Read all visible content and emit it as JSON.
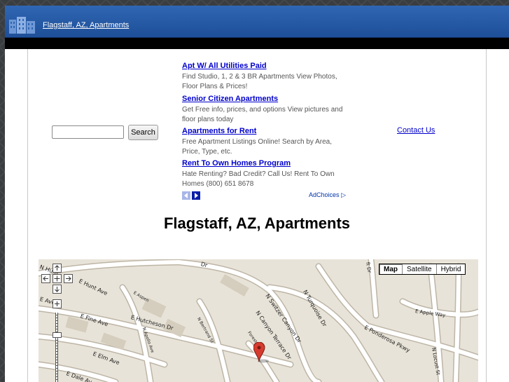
{
  "header": {
    "site_link": "Flagstaff, AZ, Apartments",
    "logo_icon": "apartment-building-icon"
  },
  "search": {
    "input_value": "",
    "button_label": "Search"
  },
  "ads": [
    {
      "title": "Apt W/ All Utilities Paid",
      "description": "Find Studio, 1, 2 & 3 BR Apartments View Photos, Floor Plans & Prices!"
    },
    {
      "title": "Senior Citizen Apartments",
      "description": "Get Free info, prices, and options View pictures and floor plans today"
    },
    {
      "title": "Apartments for Rent",
      "description": "Free Apartment Listings Online! Search by Area, Price, Type, etc."
    },
    {
      "title": "Rent To Own Homes Program",
      "description": "Hate Renting? Bad Credit? Call Us! Rent To Own Homes (800) 651 8678"
    }
  ],
  "ad_nav": {
    "adchoices_label": "AdChoices",
    "prev_icon": "chevron-left-icon",
    "next_icon": "chevron-right-icon"
  },
  "contact": {
    "label": "Contact Us"
  },
  "page_title": "Flagstaff, AZ, Apartments",
  "map": {
    "types": [
      "Map",
      "Satellite",
      "Hybrid"
    ],
    "selected_type": "Map",
    "streets": [
      "N Hum",
      "Dr",
      "E Hunt Ave",
      "E Aspen",
      "E Ave",
      "N Turquoise Dr",
      "E Ponderosa Pkwy",
      "E Hutcheson Dr",
      "E Fine Ave",
      "N Switzer Canyon Dr",
      "N Canyon Terrace Dr",
      "N Bertrand St",
      "N Apollo Ave",
      "E Apple Way",
      "E Elm Ave",
      "E Dale Av",
      "N Locust St",
      "Forest Ave",
      "ft Dr"
    ],
    "colors": {
      "land": "#e8e3d8",
      "road": "#ffffff",
      "road_edge": "#bdb5a6",
      "pin": "#d63a2e"
    }
  }
}
